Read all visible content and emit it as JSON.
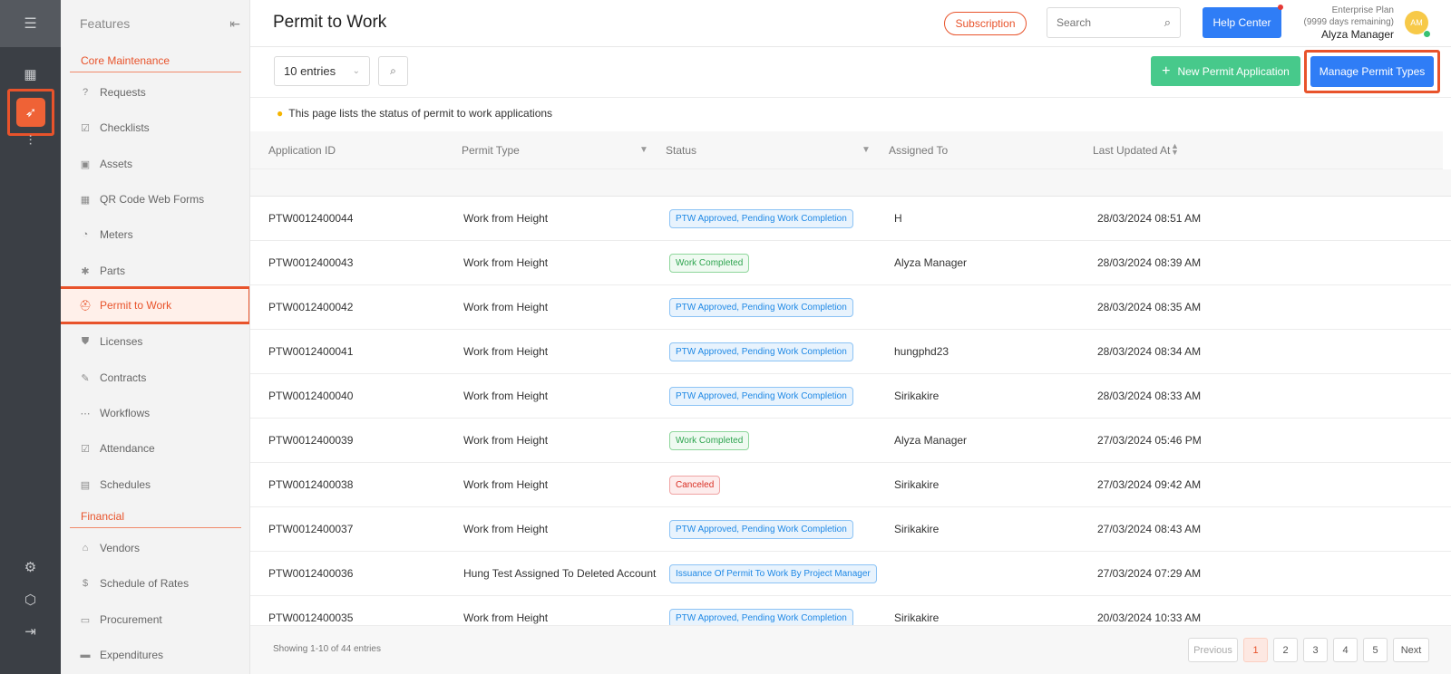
{
  "rail": {
    "items": [
      {
        "name": "menu-toggle-icon",
        "glyph": "☰"
      },
      {
        "name": "dashboard-icon",
        "glyph": "▦"
      },
      {
        "name": "rocket-icon",
        "glyph": "🚀"
      },
      {
        "name": "reports-icon",
        "glyph": "⫶"
      },
      {
        "name": "settings-icon",
        "glyph": "⚙"
      },
      {
        "name": "package-icon",
        "glyph": "⬡"
      },
      {
        "name": "logout-icon",
        "glyph": "⇥"
      }
    ]
  },
  "sidebar": {
    "title": "Features",
    "sections": {
      "core": "Core Maintenance",
      "financial": "Financial"
    },
    "items": [
      {
        "label": "Requests",
        "icon": "?"
      },
      {
        "label": "Checklists",
        "icon": "☑"
      },
      {
        "label": "Assets",
        "icon": "▣"
      },
      {
        "label": "QR Code Web Forms",
        "icon": "▦"
      },
      {
        "label": "Meters",
        "icon": "◔"
      },
      {
        "label": "Parts",
        "icon": "✱"
      },
      {
        "label": "Permit to Work",
        "icon": "⛑"
      },
      {
        "label": "Licenses",
        "icon": "⛊"
      },
      {
        "label": "Contracts",
        "icon": "✎"
      },
      {
        "label": "Workflows",
        "icon": "⋯"
      },
      {
        "label": "Attendance",
        "icon": "☑"
      },
      {
        "label": "Schedules",
        "icon": "▤"
      },
      {
        "label": "Vendors",
        "icon": "⌂"
      },
      {
        "label": "Schedule of Rates",
        "icon": "$"
      },
      {
        "label": "Procurement",
        "icon": "▭"
      },
      {
        "label": "Expenditures",
        "icon": "▬"
      }
    ]
  },
  "header": {
    "title": "Permit to Work",
    "subscription": "Subscription",
    "search_placeholder": "Search",
    "help": "Help Center",
    "plan": "Enterprise Plan",
    "days": "(9999 days remaining)",
    "user": "Alyza Manager",
    "avatar": "AM"
  },
  "toolbar": {
    "entries": "10 entries",
    "new_permit": "New Permit Application",
    "manage": "Manage Permit Types"
  },
  "info": "This page lists the status of permit to work applications",
  "table": {
    "columns": [
      "Application ID",
      "Permit Type",
      "Status",
      "Assigned To",
      "Last Updated At"
    ],
    "rows": [
      {
        "id": "PTW0012400044",
        "type": "Work from Height",
        "status": "PTW Approved, Pending Work Completion",
        "color": "blue",
        "assigned": "H",
        "updated": "28/03/2024 08:51 AM"
      },
      {
        "id": "PTW0012400043",
        "type": "Work from Height",
        "status": "Work Completed",
        "color": "green",
        "assigned": "Alyza Manager",
        "updated": "28/03/2024 08:39 AM"
      },
      {
        "id": "PTW0012400042",
        "type": "Work from Height",
        "status": "PTW Approved, Pending Work Completion",
        "color": "blue",
        "assigned": "",
        "updated": "28/03/2024 08:35 AM"
      },
      {
        "id": "PTW0012400041",
        "type": "Work from Height",
        "status": "PTW Approved, Pending Work Completion",
        "color": "blue",
        "assigned": "hungphd23",
        "updated": "28/03/2024 08:34 AM"
      },
      {
        "id": "PTW0012400040",
        "type": "Work from Height",
        "status": "PTW Approved, Pending Work Completion",
        "color": "blue",
        "assigned": "Sirikakire",
        "updated": "28/03/2024 08:33 AM"
      },
      {
        "id": "PTW0012400039",
        "type": "Work from Height",
        "status": "Work Completed",
        "color": "green",
        "assigned": "Alyza Manager",
        "updated": "27/03/2024 05:46 PM"
      },
      {
        "id": "PTW0012400038",
        "type": "Work from Height",
        "status": "Canceled",
        "color": "red",
        "assigned": "Sirikakire",
        "updated": "27/03/2024 09:42 AM"
      },
      {
        "id": "PTW0012400037",
        "type": "Work from Height",
        "status": "PTW Approved, Pending Work Completion",
        "color": "blue",
        "assigned": "Sirikakire",
        "updated": "27/03/2024 08:43 AM"
      },
      {
        "id": "PTW0012400036",
        "type": "Hung Test Assigned To Deleted Account",
        "status": "Issuance Of Permit To Work By Project Manager",
        "color": "blue",
        "assigned": "",
        "updated": "27/03/2024 07:29 AM"
      },
      {
        "id": "PTW0012400035",
        "type": "Work from Height",
        "status": "PTW Approved, Pending Work Completion",
        "color": "blue",
        "assigned": "Sirikakire",
        "updated": "20/03/2024 10:33 AM"
      }
    ]
  },
  "footer": {
    "showing": "Showing 1-10 of 44 entries",
    "previous": "Previous",
    "pages": [
      "1",
      "2",
      "3",
      "4",
      "5"
    ],
    "current_page": "1",
    "next": "Next"
  },
  "colors": {
    "accent": "#e8532b",
    "primary": "#2f7df6",
    "success": "#47c98b"
  }
}
